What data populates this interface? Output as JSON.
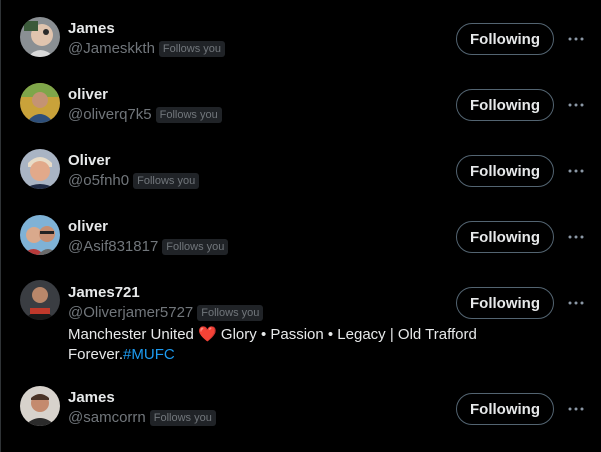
{
  "users": [
    {
      "name": "James",
      "handle": "@Jameskkth",
      "badge": "Follows you",
      "button": "Following",
      "more_icon": "more-dots-icon"
    },
    {
      "name": "oliver",
      "handle": "@oliverq7k5",
      "badge": "Follows you",
      "button": "Following",
      "more_icon": "more-dots-icon"
    },
    {
      "name": "Oliver",
      "handle": "@o5fnh0",
      "badge": "Follows you",
      "button": "Following",
      "more_icon": "more-dots-icon"
    },
    {
      "name": "oliver",
      "handle": "@Asif831817",
      "badge": "Follows you",
      "button": "Following",
      "more_icon": "more-dots-icon"
    },
    {
      "name": "James721",
      "handle": "@Oliverjamer5727",
      "badge": "Follows you",
      "button": "Following",
      "more_icon": "more-dots-icon",
      "bio": {
        "before_heart": "Manchester United ",
        "heart": "❤️",
        "after_heart": " Glory • Passion • Legacy | Old Trafford Forever.",
        "hashtag": "#MUFC"
      }
    },
    {
      "name": "James",
      "handle": "@samcorrn",
      "badge": "Follows you",
      "button": "Following",
      "more_icon": "more-dots-icon"
    }
  ],
  "colors": {
    "background": "#000000",
    "text_primary": "#e7e9ea",
    "text_secondary": "#71767b",
    "badge_bg": "#202327",
    "button_border": "#536471",
    "hashtag": "#1d9bf0",
    "heart": "#f4212e"
  }
}
